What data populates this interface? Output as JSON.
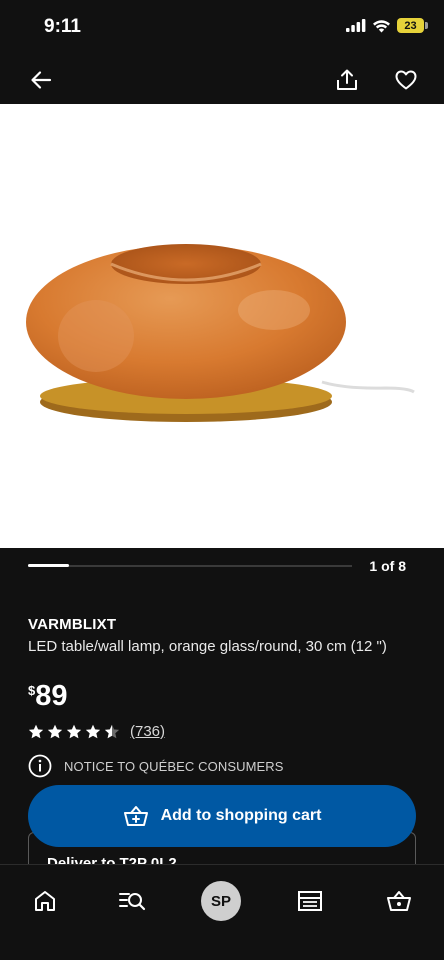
{
  "status_bar": {
    "time": "9:11",
    "battery": "23"
  },
  "product": {
    "name": "VARMBLIXT",
    "description": "LED table/wall lamp, orange glass/round, 30 cm (12 \")",
    "currency": "$",
    "price": "89",
    "rating": 4.5,
    "review_count": "(736)"
  },
  "carousel": {
    "counter": "1 of 8",
    "progress": 0.125
  },
  "notice": {
    "label": "NOTICE TO QUÉBEC CONSUMERS"
  },
  "cart_button": {
    "label": "Add to shopping cart"
  },
  "delivery": {
    "label": "Deliver to T2P 0L2"
  },
  "tab_bar": {
    "avatar_initials": "SP"
  },
  "colors": {
    "accent_blue": "#0058a3",
    "background": "#111111",
    "lamp_orange": "#d9782e"
  },
  "icons": [
    "back-arrow-icon",
    "share-icon",
    "heart-icon",
    "info-icon",
    "cart-add-icon",
    "home-icon",
    "search-list-icon",
    "store-icon",
    "basket-icon"
  ]
}
